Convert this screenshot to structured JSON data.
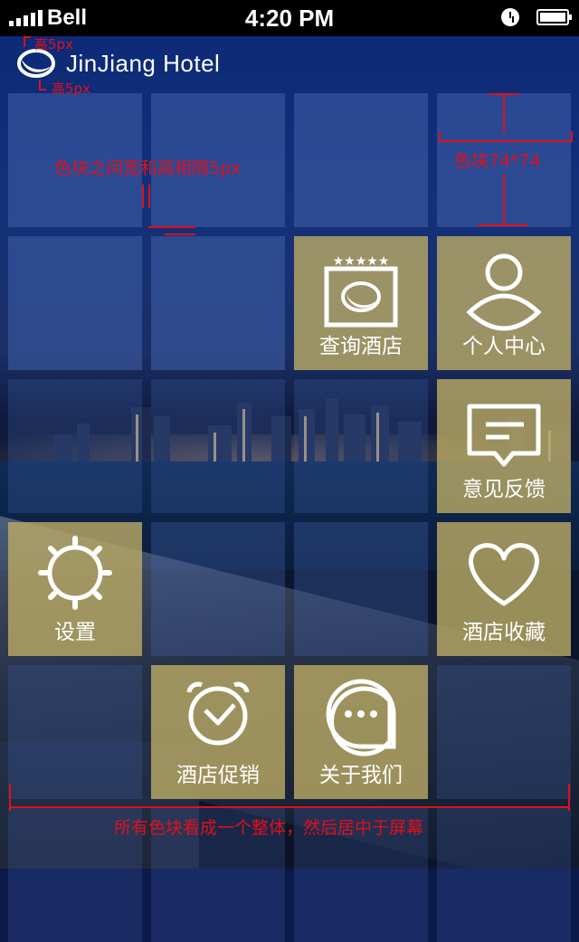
{
  "status_bar": {
    "carrier": "Bell",
    "time": "4:20 PM"
  },
  "header": {
    "brand": "JinJiang Hotel"
  },
  "tiles": [
    {
      "label": "查询酒店",
      "icon": "hotel-card-icon"
    },
    {
      "label": "个人中心",
      "icon": "person-icon"
    },
    {
      "label": "意见反馈",
      "icon": "feedback-icon"
    },
    {
      "label": "设置",
      "icon": "gear-icon"
    },
    {
      "label": "酒店收藏",
      "icon": "heart-icon"
    },
    {
      "label": "酒店促销",
      "icon": "alarm-clock-icon"
    },
    {
      "label": "关于我们",
      "icon": "chat-icon"
    }
  ],
  "annotations": {
    "height_top": "高5px",
    "height_bottom": "高5px",
    "gap": "色块之间宽和高相隔5px",
    "block_size": "色块74*74",
    "center_note": "所有色块看成一个整体，然后居中于屏幕"
  },
  "colors": {
    "tile_blue": "#4260aa",
    "tile_gold": "#b8a864",
    "annotation_red": "#e0101a"
  }
}
